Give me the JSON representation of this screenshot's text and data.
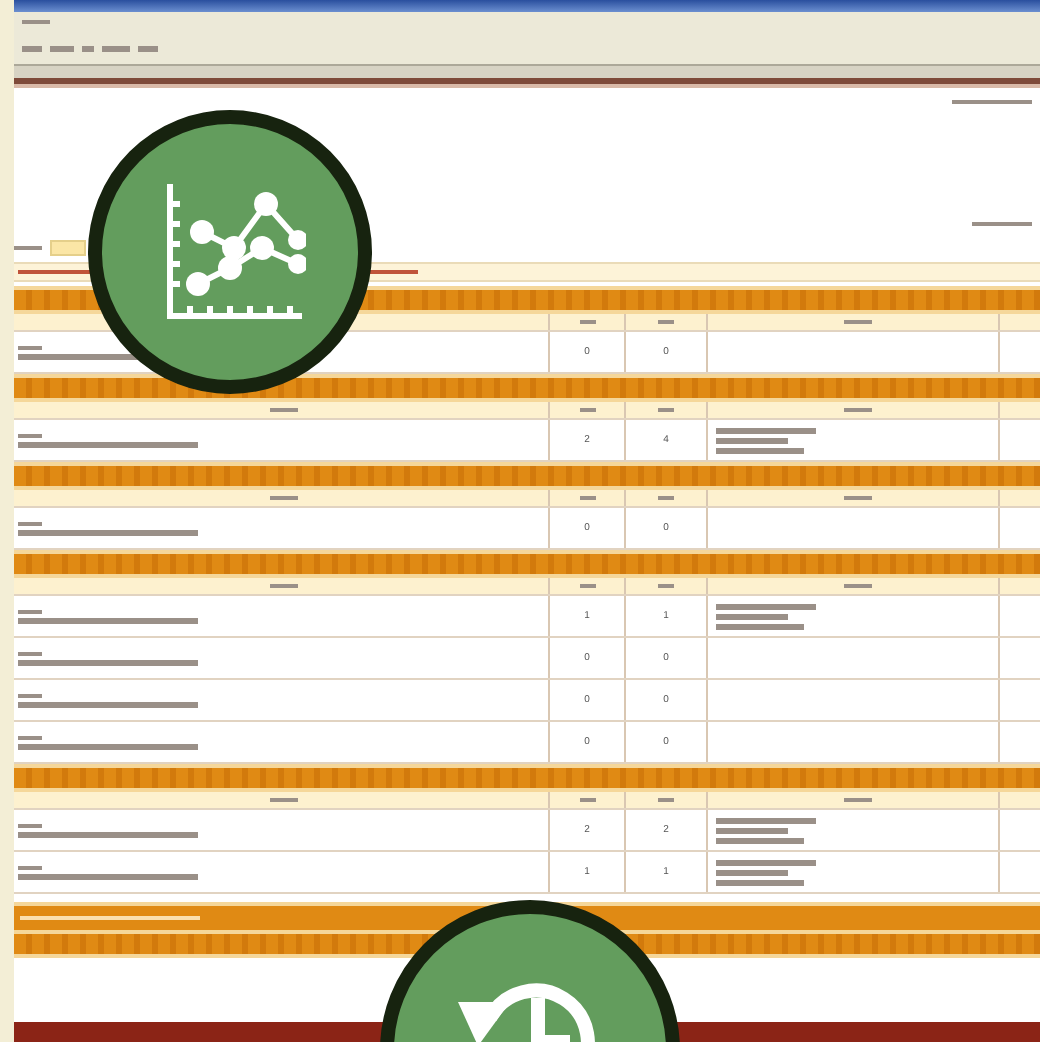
{
  "sections": [
    {
      "rows": [
        {
          "topics": "0",
          "posts": "0",
          "last_post": false
        }
      ]
    },
    {
      "rows": [
        {
          "topics": "2",
          "posts": "4",
          "last_post": true
        }
      ]
    },
    {
      "rows": [
        {
          "topics": "0",
          "posts": "0",
          "last_post": false
        }
      ]
    },
    {
      "rows": [
        {
          "topics": "1",
          "posts": "1",
          "last_post": true
        },
        {
          "topics": "0",
          "posts": "0",
          "last_post": false
        },
        {
          "topics": "0",
          "posts": "0",
          "last_post": false
        },
        {
          "topics": "0",
          "posts": "0",
          "last_post": false
        }
      ]
    },
    {
      "rows": [
        {
          "topics": "2",
          "posts": "2",
          "last_post": true
        },
        {
          "topics": "1",
          "posts": "1",
          "last_post": true
        }
      ]
    }
  ],
  "overlays": [
    {
      "kind": "chart"
    },
    {
      "kind": "history"
    }
  ]
}
